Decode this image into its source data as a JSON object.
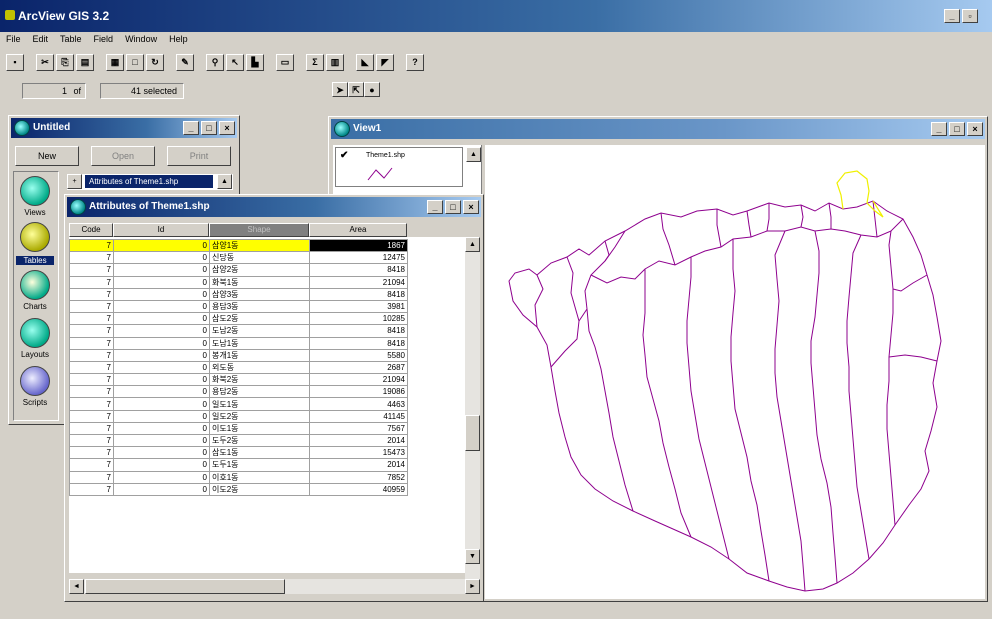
{
  "app": {
    "title": "ArcView GIS 3.2"
  },
  "menu": [
    "File",
    "Edit",
    "Table",
    "Field",
    "Window",
    "Help"
  ],
  "status": {
    "current": "1",
    "of_label": "of",
    "selected": "41 selected"
  },
  "project": {
    "title": "Untitled",
    "buttons": {
      "new": "New",
      "open": "Open",
      "print": "Print"
    },
    "doc_tab": "Attributes of Theme1.shp",
    "sidebar": [
      "Views",
      "Tables",
      "Charts",
      "Layouts",
      "Scripts"
    ]
  },
  "attr_table": {
    "title": "Attributes of Theme1.shp",
    "columns": [
      "Code",
      "Id",
      "Shape",
      "Area"
    ],
    "rows": [
      [
        "7",
        "0",
        "삼양1동",
        "1867"
      ],
      [
        "7",
        "0",
        "신당동",
        "12475"
      ],
      [
        "7",
        "0",
        "삼양2동",
        "8418"
      ],
      [
        "7",
        "0",
        "화북1동",
        "21094"
      ],
      [
        "7",
        "0",
        "삼양3동",
        "8418"
      ],
      [
        "7",
        "0",
        "용담3동",
        "3981"
      ],
      [
        "7",
        "0",
        "삼도2동",
        "10285"
      ],
      [
        "7",
        "0",
        "도남2동",
        "8418"
      ],
      [
        "7",
        "0",
        "도남1동",
        "8418"
      ],
      [
        "7",
        "0",
        "봉개1동",
        "5580"
      ],
      [
        "7",
        "0",
        "외도동",
        "2687"
      ],
      [
        "7",
        "0",
        "화북2동",
        "21094"
      ],
      [
        "7",
        "0",
        "용담2동",
        "19086"
      ],
      [
        "7",
        "0",
        "일도1동",
        "4463"
      ],
      [
        "7",
        "0",
        "일도2동",
        "41145"
      ],
      [
        "7",
        "0",
        "이도1동",
        "7567"
      ],
      [
        "7",
        "0",
        "도두2동",
        "2014"
      ],
      [
        "7",
        "0",
        "삼도1동",
        "15473"
      ],
      [
        "7",
        "0",
        "도두1동",
        "2014"
      ],
      [
        "7",
        "0",
        "이호1동",
        "7852"
      ],
      [
        "7",
        "0",
        "이도2동",
        "40959"
      ]
    ]
  },
  "view": {
    "title": "View1",
    "theme": "Theme1.shp",
    "colors": {
      "map_lines": "#8e008e",
      "highlight": "#f0f000"
    }
  }
}
